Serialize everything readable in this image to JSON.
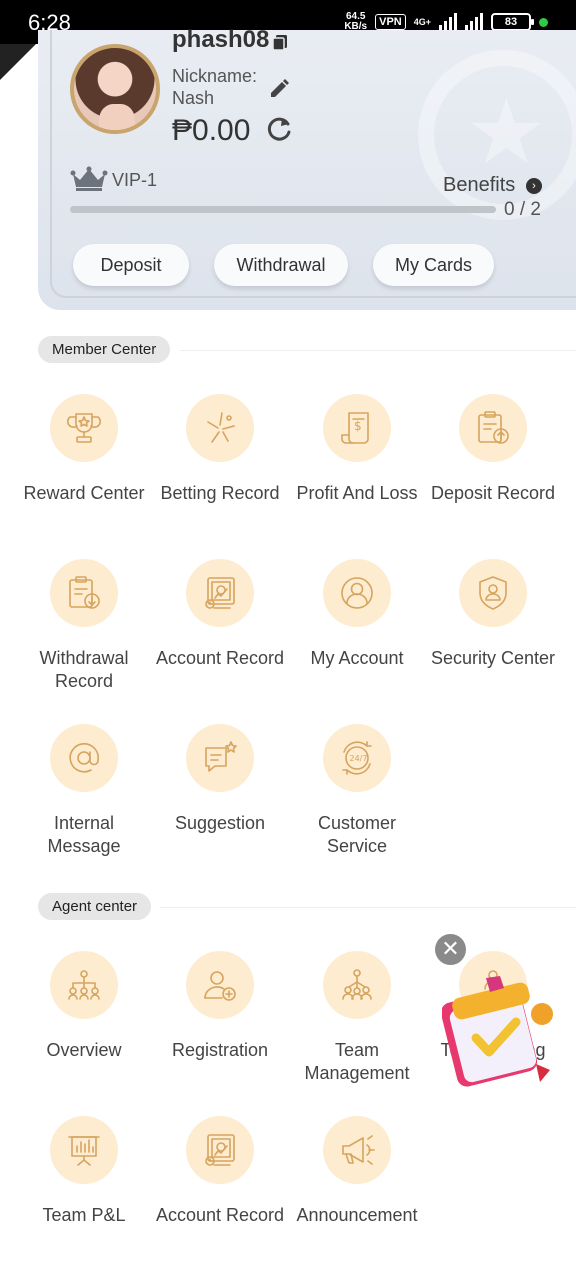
{
  "status_bar": {
    "time": "6:28",
    "net_speed_value": "64.5",
    "net_speed_unit": "KB/s",
    "vpn": "VPN",
    "network_type": "4G+",
    "battery": "83"
  },
  "profile": {
    "username": "phash08",
    "nickname_label": "Nickname:",
    "nickname_value": "Nash",
    "balance": "₱0.00",
    "vip_level": "VIP-1",
    "benefits_label": "Benefits",
    "progress_text": "0 / 2",
    "progress_fraction": 0.0
  },
  "actions": {
    "deposit": "Deposit",
    "withdrawal": "Withdrawal",
    "my_cards": "My Cards"
  },
  "member_center": {
    "title": "Member Center",
    "items": [
      {
        "label": "Reward Center",
        "icon": "trophy-icon"
      },
      {
        "label": "Betting Record",
        "icon": "sparkle-icon"
      },
      {
        "label": "Profit And Loss",
        "icon": "receipt-dollar-icon"
      },
      {
        "label": "Deposit Record",
        "icon": "clipboard-upload-icon"
      },
      {
        "label": "Withdrawal Record",
        "icon": "clipboard-download-icon"
      },
      {
        "label": "Account Record",
        "icon": "ledger-icon"
      },
      {
        "label": "My Account",
        "icon": "user-icon"
      },
      {
        "label": "Security Center",
        "icon": "shield-user-icon"
      },
      {
        "label": "Internal Message",
        "icon": "at-sign-icon"
      },
      {
        "label": "Suggestion",
        "icon": "chat-star-icon"
      },
      {
        "label": "Customer Service",
        "icon": "support-24-7-icon"
      }
    ]
  },
  "agent_center": {
    "title": "Agent center",
    "items": [
      {
        "label": "Overview",
        "icon": "org-chart-icon"
      },
      {
        "label": "Registration",
        "icon": "user-add-icon"
      },
      {
        "label": "Team Management",
        "icon": "team-icon"
      },
      {
        "label": "Team Betting",
        "icon": "team-betting-icon"
      },
      {
        "label": "Team P&L",
        "icon": "presentation-chart-icon"
      },
      {
        "label": "Account Record",
        "icon": "ledger-icon"
      },
      {
        "label": "Announcement",
        "icon": "megaphone-icon"
      }
    ]
  },
  "floating": {
    "close": "✕"
  }
}
